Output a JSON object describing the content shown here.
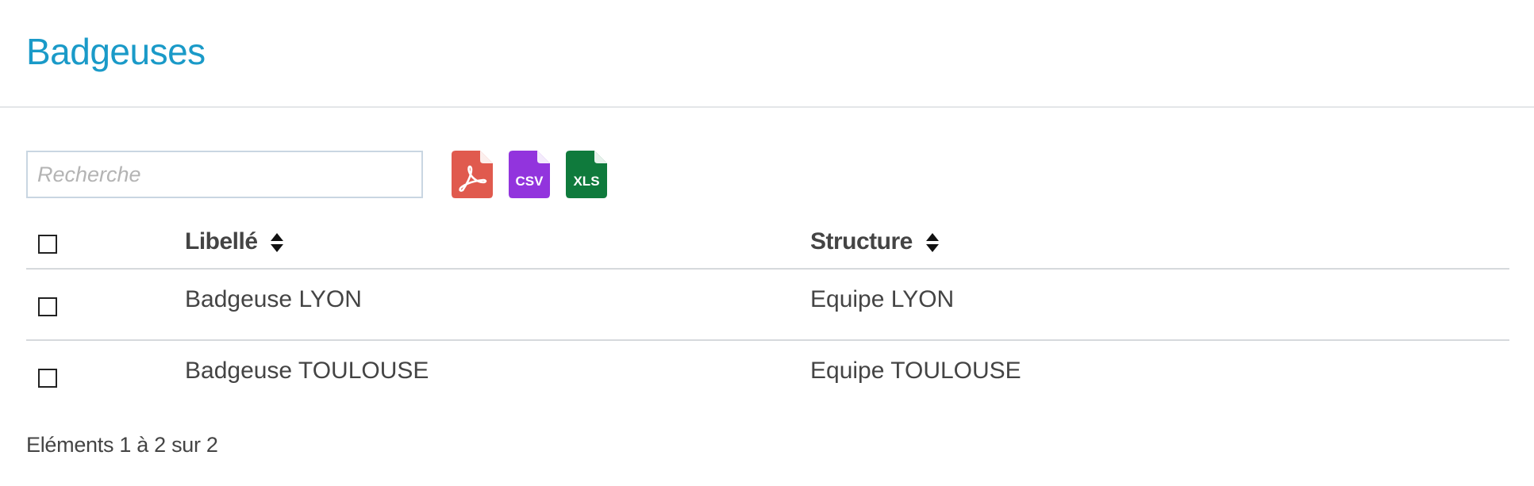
{
  "page": {
    "title": "Badgeuses"
  },
  "search": {
    "placeholder": "Recherche",
    "value": ""
  },
  "exports": {
    "csv_label": "CSV",
    "xls_label": "XLS",
    "pdf_color": "#e05a4e",
    "csv_color": "#9234dd",
    "xls_color": "#0f7a3c"
  },
  "table": {
    "columns": {
      "label": "Libellé",
      "structure": "Structure"
    },
    "rows": [
      {
        "label": "Badgeuse LYON",
        "structure": "Equipe LYON"
      },
      {
        "label": "Badgeuse TOULOUSE",
        "structure": "Equipe TOULOUSE"
      }
    ]
  },
  "pagination": {
    "info": "Eléments 1 à 2 sur 2"
  },
  "colors": {
    "title": "#1a9ac8",
    "text": "#444444",
    "divider": "#d6d9dc"
  }
}
